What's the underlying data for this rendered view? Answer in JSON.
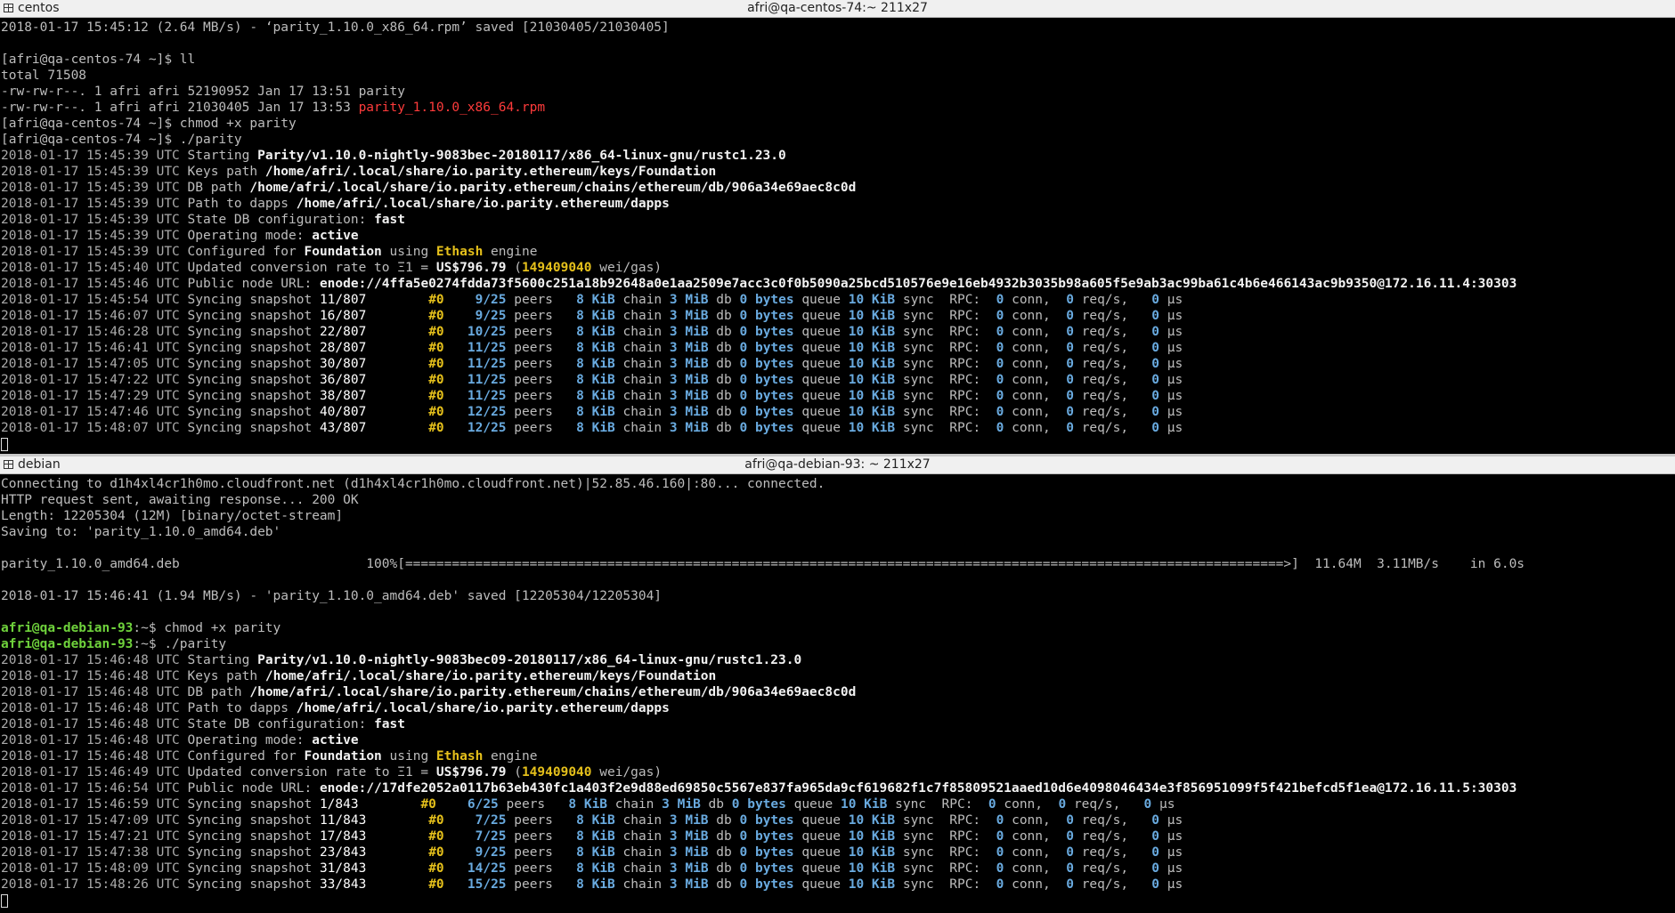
{
  "pane1": {
    "tab_name": "centos",
    "window_title": "afri@qa-centos-74:~ 211x27",
    "pre_lines": [
      {
        "text": "2018-01-17 15:45:12 (2.64 MB/s) - ‘parity_1.10.0_x86_64.rpm’ saved [21030405/21030405]"
      },
      {
        "text": ""
      },
      {
        "text": "[afri@qa-centos-74 ~]$ ll"
      },
      {
        "text": "total 71508"
      },
      {
        "text": "-rw-rw-r--. 1 afri afri 52190952 Jan 17 13:51 parity"
      },
      {
        "text": "-rw-rw-r--. 1 afri afri 21030405 Jan 17 13:53 ",
        "red": "parity_1.10.0_x86_64.rpm"
      },
      {
        "text": "[afri@qa-centos-74 ~]$ chmod +x parity"
      },
      {
        "text": "[afri@qa-centos-74 ~]$ ./parity"
      }
    ],
    "log": [
      {
        "time": "2018-01-17 15:45:39 UTC",
        "label": "Starting",
        "value": "Parity/v1.10.0-nightly-9083bec-20180117/x86_64-linux-gnu/rustc1.23.0"
      },
      {
        "time": "2018-01-17 15:45:39 UTC",
        "label": "Keys path",
        "value": "/home/afri/.local/share/io.parity.ethereum/keys/Foundation"
      },
      {
        "time": "2018-01-17 15:45:39 UTC",
        "label": "DB path",
        "value": "/home/afri/.local/share/io.parity.ethereum/chains/ethereum/db/906a34e69aec8c0d"
      },
      {
        "time": "2018-01-17 15:45:39 UTC",
        "label": "Path to dapps",
        "value": "/home/afri/.local/share/io.parity.ethereum/dapps"
      },
      {
        "time": "2018-01-17 15:45:39 UTC",
        "label": "State DB configuration:",
        "value": "fast"
      },
      {
        "time": "2018-01-17 15:45:39 UTC",
        "label": "Operating mode:",
        "value": "active"
      }
    ],
    "configured": {
      "time": "2018-01-17 15:45:39 UTC",
      "pre": "Configured for",
      "chain": "Foundation",
      "mid": "using",
      "engine": "Ethash",
      "post": "engine"
    },
    "rate": {
      "time": "2018-01-17 15:45:40 UTC",
      "pre": "Updated conversion rate to Ξ1 =",
      "price": "US$796.79",
      "open": "(",
      "gas": "149409040",
      "post": "wei/gas)"
    },
    "node": {
      "time": "2018-01-17 15:45:46 UTC",
      "label": "Public node URL:",
      "url": "enode://4ffa5e0274fdda73f5600c251a18b92648a0e1aa2509e7acc3c0f0b5090a25bcd510576e9e16eb4932b3035b98a605f5e9ab3ac99ba61c4b6e466143ac9b9350@172.16.11.4:30303"
    },
    "sync": [
      {
        "time": "2018-01-17 15:45:54 UTC",
        "snap": "11/807",
        "pad": "        ",
        "blk": "#0",
        "ps": "    ",
        "pc": "9",
        "pt": "25"
      },
      {
        "time": "2018-01-17 15:46:07 UTC",
        "snap": "16/807",
        "pad": "        ",
        "blk": "#0",
        "ps": "    ",
        "pc": "9",
        "pt": "25"
      },
      {
        "time": "2018-01-17 15:46:28 UTC",
        "snap": "22/807",
        "pad": "        ",
        "blk": "#0",
        "ps": "   ",
        "pc": "10",
        "pt": "25"
      },
      {
        "time": "2018-01-17 15:46:41 UTC",
        "snap": "28/807",
        "pad": "        ",
        "blk": "#0",
        "ps": "   ",
        "pc": "11",
        "pt": "25"
      },
      {
        "time": "2018-01-17 15:47:05 UTC",
        "snap": "30/807",
        "pad": "        ",
        "blk": "#0",
        "ps": "   ",
        "pc": "11",
        "pt": "25"
      },
      {
        "time": "2018-01-17 15:47:22 UTC",
        "snap": "36/807",
        "pad": "        ",
        "blk": "#0",
        "ps": "   ",
        "pc": "11",
        "pt": "25"
      },
      {
        "time": "2018-01-17 15:47:29 UTC",
        "snap": "38/807",
        "pad": "        ",
        "blk": "#0",
        "ps": "   ",
        "pc": "11",
        "pt": "25"
      },
      {
        "time": "2018-01-17 15:47:46 UTC",
        "snap": "40/807",
        "pad": "        ",
        "blk": "#0",
        "ps": "   ",
        "pc": "12",
        "pt": "25"
      },
      {
        "time": "2018-01-17 15:48:07 UTC",
        "snap": "43/807",
        "pad": "        ",
        "blk": "#0",
        "ps": "   ",
        "pc": "12",
        "pt": "25"
      }
    ]
  },
  "pane2": {
    "tab_name": "debian",
    "window_title": "afri@qa-debian-93: ~ 211x27",
    "pre_lines": [
      {
        "text": "Connecting to d1h4xl4cr1h0mo.cloudfront.net (d1h4xl4cr1h0mo.cloudfront.net)|52.85.46.160|:80... connected."
      },
      {
        "text": "HTTP request sent, awaiting response... 200 OK"
      },
      {
        "text": "Length: 12205304 (12M) [binary/octet-stream]"
      },
      {
        "text": "Saving to: 'parity_1.10.0_amd64.deb'"
      },
      {
        "text": ""
      },
      {
        "text": "parity_1.10.0_amd64.deb                        100%[=================================================================================================================>]  11.64M  3.11MB/s    in 6.0s"
      },
      {
        "text": ""
      },
      {
        "text": "2018-01-17 15:46:41 (1.94 MB/s) - 'parity_1.10.0_amd64.deb' saved [12205304/12205304]"
      },
      {
        "text": ""
      },
      {
        "prompt": "afri@qa-debian-93",
        "text": ":~$ chmod +x parity"
      },
      {
        "prompt": "afri@qa-debian-93",
        "text": ":~$ ./parity"
      }
    ],
    "log": [
      {
        "time": "2018-01-17 15:46:48 UTC",
        "label": "Starting",
        "value": "Parity/v1.10.0-nightly-9083bec09-20180117/x86_64-linux-gnu/rustc1.23.0"
      },
      {
        "time": "2018-01-17 15:46:48 UTC",
        "label": "Keys path",
        "value": "/home/afri/.local/share/io.parity.ethereum/keys/Foundation"
      },
      {
        "time": "2018-01-17 15:46:48 UTC",
        "label": "DB path",
        "value": "/home/afri/.local/share/io.parity.ethereum/chains/ethereum/db/906a34e69aec8c0d"
      },
      {
        "time": "2018-01-17 15:46:48 UTC",
        "label": "Path to dapps",
        "value": "/home/afri/.local/share/io.parity.ethereum/dapps"
      },
      {
        "time": "2018-01-17 15:46:48 UTC",
        "label": "State DB configuration:",
        "value": "fast"
      },
      {
        "time": "2018-01-17 15:46:48 UTC",
        "label": "Operating mode:",
        "value": "active"
      }
    ],
    "configured": {
      "time": "2018-01-17 15:46:48 UTC",
      "pre": "Configured for",
      "chain": "Foundation",
      "mid": "using",
      "engine": "Ethash",
      "post": "engine"
    },
    "rate": {
      "time": "2018-01-17 15:46:49 UTC",
      "pre": "Updated conversion rate to Ξ1 =",
      "price": "US$796.79",
      "open": "(",
      "gas": "149409040",
      "post": "wei/gas)"
    },
    "node": {
      "time": "2018-01-17 15:46:54 UTC",
      "label": "Public node URL:",
      "url": "enode://17dfe2052a0117b63eb430fc1a403f2e9d88ed69850c5567e837fa965da9cf619682f1c7f85809521aaed10d6e4098046434e3f856951099f5f421befcd5f1ea@172.16.11.5:30303"
    },
    "sync": [
      {
        "time": "2018-01-17 15:46:59 UTC",
        "snap": "1/843",
        "pad": "        ",
        "blk": "#0",
        "ps": "    ",
        "pc": "6",
        "pt": "25"
      },
      {
        "time": "2018-01-17 15:47:09 UTC",
        "snap": "11/843",
        "pad": "        ",
        "blk": "#0",
        "ps": "    ",
        "pc": "7",
        "pt": "25"
      },
      {
        "time": "2018-01-17 15:47:21 UTC",
        "snap": "17/843",
        "pad": "        ",
        "blk": "#0",
        "ps": "    ",
        "pc": "7",
        "pt": "25"
      },
      {
        "time": "2018-01-17 15:47:38 UTC",
        "snap": "23/843",
        "pad": "        ",
        "blk": "#0",
        "ps": "    ",
        "pc": "9",
        "pt": "25"
      },
      {
        "time": "2018-01-17 15:48:09 UTC",
        "snap": "31/843",
        "pad": "        ",
        "blk": "#0",
        "ps": "   ",
        "pc": "14",
        "pt": "25"
      },
      {
        "time": "2018-01-17 15:48:26 UTC",
        "snap": "33/843",
        "pad": "        ",
        "blk": "#0",
        "ps": "   ",
        "pc": "15",
        "pt": "25"
      }
    ]
  },
  "sync_fixed": {
    "label": "Syncing snapshot",
    "peers": "peers",
    "kib": "8 KiB",
    "chain": "chain",
    "mib": "3 MiB",
    "db": "db",
    "bytes": "0 bytes",
    "queue": "queue",
    "sync_kib": "10 KiB",
    "sync": "sync",
    "rpc": "RPC:",
    "conn_n": "0",
    "conn": "conn,",
    "req_n": "0",
    "req": "req/s,",
    "us_n": "0",
    "us": "µs"
  },
  "colors": {
    "background": "#000000",
    "text": "#bdbdbd",
    "highlight_yellow": "#e5c01b",
    "highlight_blue": "#69aadf",
    "prompt_green": "#6fd23c",
    "file_red": "#ff3b3b"
  },
  "icons": {
    "tab_icon": "terminal-icon"
  }
}
